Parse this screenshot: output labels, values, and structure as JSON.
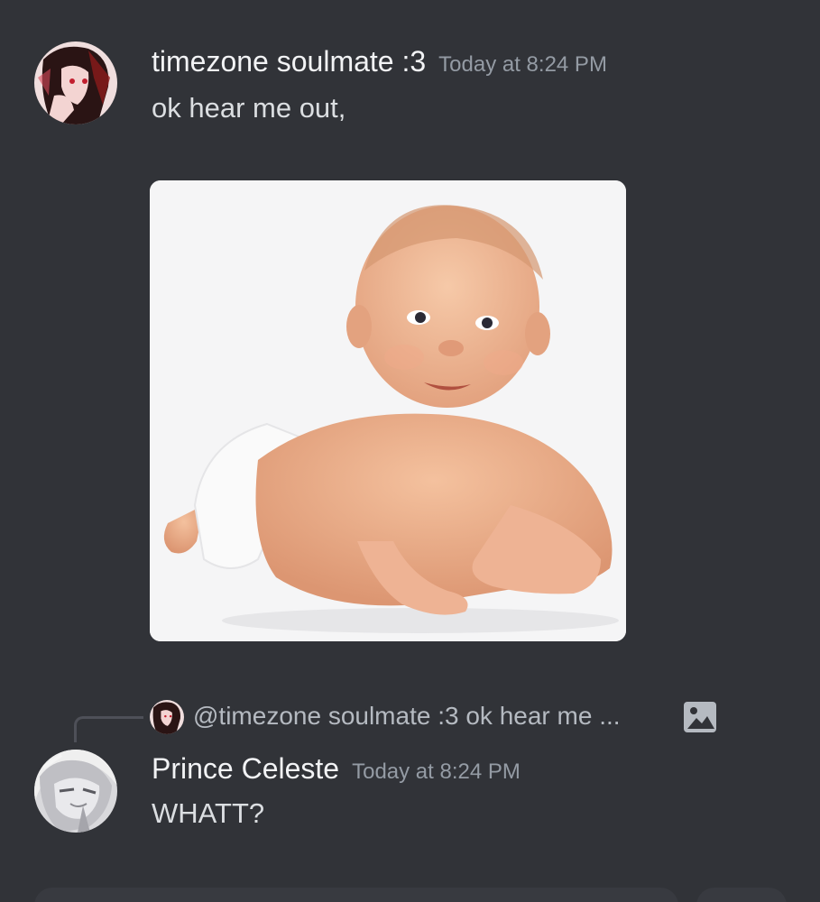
{
  "messages": [
    {
      "author": "timezone soulmate :3",
      "timestamp": "Today at 8:24 PM",
      "text": "ok hear me out,",
      "avatar": "anime-character-avatar",
      "attachment": "baby-photo"
    },
    {
      "author": "Prince Celeste",
      "timestamp": "Today at 8:24 PM",
      "text": "WHATT?",
      "avatar": "anime-character-avatar",
      "reply": {
        "preview": "@timezone soulmate :3 ok hear me ...",
        "icon": "image-icon"
      }
    }
  ],
  "colors": {
    "background": "#313338",
    "username": "#f2f3f5",
    "timestamp": "#949ba4",
    "message_text": "#dbdee1",
    "reply_line": "#4e5058"
  }
}
